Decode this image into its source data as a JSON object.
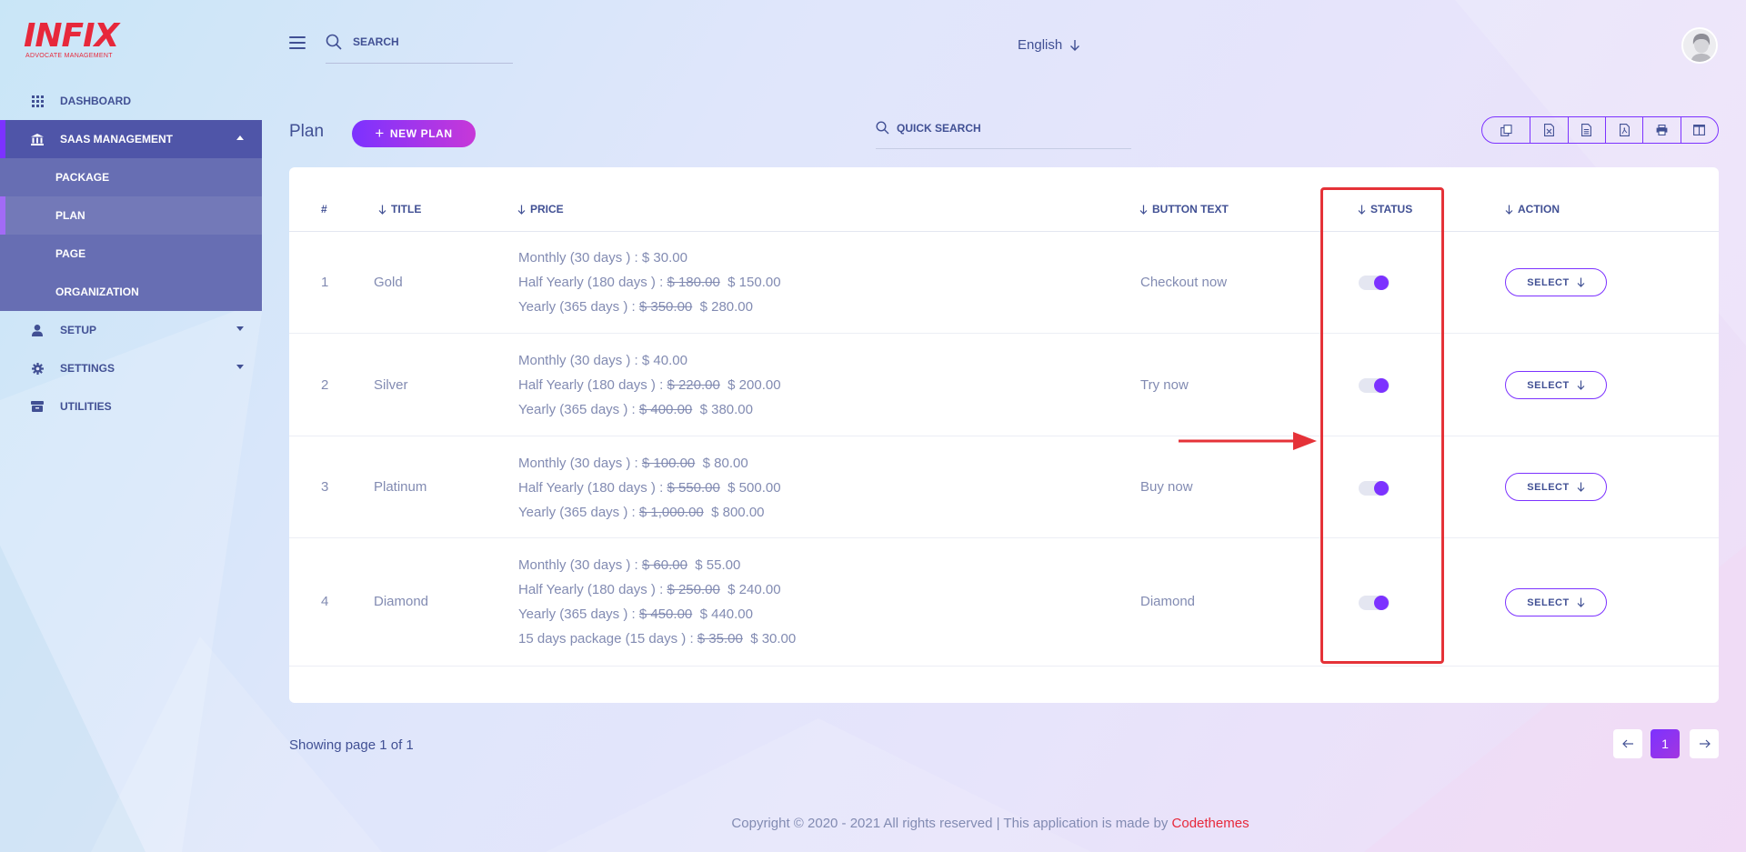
{
  "brand": {
    "logo_text": "INFIX",
    "logo_sub": "Advocate Management",
    "color": "#e7283b"
  },
  "sidebar": {
    "items": [
      {
        "label": "DASHBOARD",
        "icon": "grid-icon"
      },
      {
        "label": "SAAS MANAGEMENT",
        "icon": "bank-icon",
        "active": true,
        "children": [
          "PACKAGE",
          "PLAN",
          "PAGE",
          "ORGANIZATION"
        ],
        "current_child": "PLAN"
      },
      {
        "label": "SETUP",
        "icon": "user-icon"
      },
      {
        "label": "SETTINGS",
        "icon": "gear-icon"
      },
      {
        "label": "UTILITIES",
        "icon": "archive-icon"
      }
    ]
  },
  "topbar": {
    "search_placeholder": "SEARCH",
    "language": "English"
  },
  "header": {
    "title": "Plan",
    "new_button": "NEW PLAN",
    "quick_search_placeholder": "QUICK SEARCH",
    "export_icons": [
      "copy-icon",
      "excel-icon",
      "csv-icon",
      "pdf-icon",
      "print-icon",
      "columns-icon"
    ]
  },
  "table": {
    "columns": [
      "#",
      "TITLE",
      "PRICE",
      "BUTTON TEXT",
      "STATUS",
      "ACTION"
    ],
    "rows": [
      {
        "num": "1",
        "title": "Gold",
        "button_text": "Checkout now",
        "status": true,
        "action": "SELECT",
        "prices": [
          {
            "label": "Monthly (30 days ) :",
            "old": "",
            "price": "$ 30.00"
          },
          {
            "label": "Half Yearly (180 days ) :",
            "old": "$ 180.00",
            "price": "$ 150.00"
          },
          {
            "label": "Yearly (365 days ) :",
            "old": "$ 350.00",
            "price": "$ 280.00"
          }
        ]
      },
      {
        "num": "2",
        "title": "Silver",
        "button_text": "Try now",
        "status": true,
        "action": "SELECT",
        "prices": [
          {
            "label": "Monthly (30 days ) :",
            "old": "",
            "price": "$ 40.00"
          },
          {
            "label": "Half Yearly (180 days ) :",
            "old": "$ 220.00",
            "price": "$ 200.00"
          },
          {
            "label": "Yearly (365 days ) :",
            "old": "$ 400.00",
            "price": "$ 380.00"
          }
        ]
      },
      {
        "num": "3",
        "title": "Platinum",
        "button_text": "Buy now",
        "status": true,
        "action": "SELECT",
        "prices": [
          {
            "label": "Monthly (30 days ) :",
            "old": "$ 100.00",
            "price": "$ 80.00"
          },
          {
            "label": "Half Yearly (180 days ) :",
            "old": "$ 550.00",
            "price": "$ 500.00"
          },
          {
            "label": "Yearly (365 days ) :",
            "old": "$ 1,000.00",
            "price": "$ 800.00"
          }
        ]
      },
      {
        "num": "4",
        "title": "Diamond",
        "button_text": "Diamond",
        "status": true,
        "action": "SELECT",
        "prices": [
          {
            "label": "Monthly (30 days ) :",
            "old": "$ 60.00",
            "price": "$ 55.00"
          },
          {
            "label": "Half Yearly (180 days ) :",
            "old": "$ 250.00",
            "price": "$ 240.00"
          },
          {
            "label": "Yearly (365 days ) :",
            "old": "$ 450.00",
            "price": "$ 440.00"
          },
          {
            "label": "15 days package (15 days ) :",
            "old": "$ 35.00",
            "price": "$ 30.00"
          }
        ]
      }
    ]
  },
  "pagination": {
    "summary": "Showing page 1 of 1",
    "current": "1"
  },
  "footer": {
    "text": "Copyright © 2020 - 2021 All rights reserved | This application is made by ",
    "brand": "Codethemes"
  },
  "colors": {
    "accent": "#7c32ff",
    "primary_text": "#415094",
    "muted_text": "#828bb2",
    "annotation": "#e53238",
    "sidebar_active": "#4f55a8"
  }
}
